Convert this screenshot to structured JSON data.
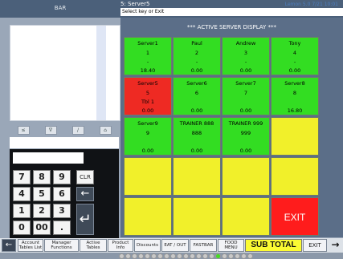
{
  "header": {
    "bar_label": "BAR",
    "title": "5: Server5",
    "subtitle": "Select key or Exit",
    "corner_info": "Lemon 5.0 7/21 10:01"
  },
  "left": {
    "small_buttons": [
      "≤",
      "∇",
      "/",
      "⌂"
    ]
  },
  "keypad": {
    "keys": [
      "7",
      "8",
      "9",
      "4",
      "5",
      "6",
      "1",
      "2",
      "3",
      "0",
      "00",
      "."
    ],
    "clr": "CLR",
    "backspace": "←",
    "enter": "↵"
  },
  "main": {
    "panel_title": "*** ACTIVE SERVER DISPLAY ***",
    "tiles": [
      {
        "name": "Server1",
        "num": "1",
        "tables": "-",
        "amount": "18.40",
        "color": "green"
      },
      {
        "name": "Paul",
        "num": "2",
        "tables": "-",
        "amount": "0.00",
        "color": "green"
      },
      {
        "name": "Andrew",
        "num": "3",
        "tables": "-",
        "amount": "0.00",
        "color": "green"
      },
      {
        "name": "Tony",
        "num": "4",
        "tables": "-",
        "amount": "0.00",
        "color": "green"
      },
      {
        "name": "Server5",
        "num": "5",
        "tables": "Tbl 1",
        "amount": "0.00",
        "color": "red"
      },
      {
        "name": "Server6",
        "num": "6",
        "tables": "",
        "amount": "0.00",
        "color": "green"
      },
      {
        "name": "Server7",
        "num": "7",
        "tables": "",
        "amount": "0.00",
        "color": "green"
      },
      {
        "name": "Server8",
        "num": "8",
        "tables": "",
        "amount": "16.80",
        "color": "green"
      },
      {
        "name": "Server9",
        "num": "9",
        "tables": "",
        "amount": "0.00",
        "color": "green"
      },
      {
        "name": "TRAINER 888",
        "num": "888",
        "tables": "",
        "amount": "0.00",
        "color": "green"
      },
      {
        "name": "TRAINER 999",
        "num": "999",
        "tables": "",
        "amount": "0.00",
        "color": "green"
      }
    ],
    "exit_label": "EXIT"
  },
  "bottom": {
    "account": "Account Tables List",
    "manager": "Manager Functions",
    "active": "Active Tables",
    "product": "Product Info",
    "discounts": "Discounts",
    "eatout": "EAT / OUT",
    "fastbar": "FASTBAR",
    "foodmenu": "FOOD MENU",
    "subtotal": "SUB TOTAL",
    "exit": "EXIT"
  }
}
